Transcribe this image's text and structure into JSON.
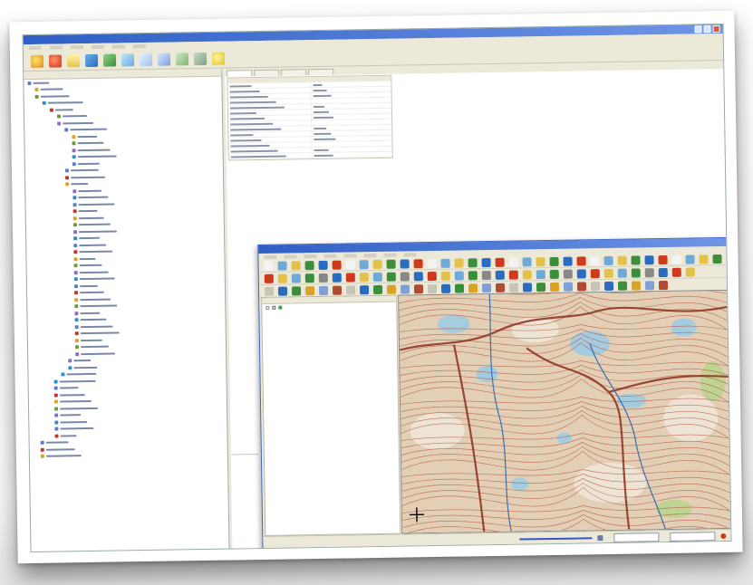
{
  "app": {
    "title": "",
    "menus": [
      "",
      "",
      "",
      "",
      "",
      ""
    ]
  },
  "toolbar": {
    "icons": [
      "refresh-icon",
      "connect-icon",
      "folder-icon",
      "layer-icon",
      "settings-icon",
      "add-icon",
      "table-icon",
      "sql-icon",
      "import-icon",
      "export-icon",
      "help-icon"
    ]
  },
  "tree": {
    "header": "",
    "items": [
      "",
      "",
      "",
      "",
      "",
      "",
      "",
      "",
      "",
      ""
    ]
  },
  "properties": {
    "tabs": [
      "",
      "",
      "",
      ""
    ],
    "columns": [
      "",
      ""
    ],
    "rows": [
      "",
      "",
      "",
      "",
      "",
      "",
      "",
      "",
      "",
      "",
      "",
      "",
      "",
      ""
    ]
  },
  "map_window": {
    "title": "",
    "menus": [
      "",
      "",
      "",
      "",
      "",
      "",
      "",
      ""
    ],
    "layer_name": "",
    "status": {
      "link": "",
      "coordinate_label": "",
      "coordinate_value": "",
      "scale_label": "",
      "scale_value": ""
    }
  },
  "colors": {
    "titlebar": "#2f5fc6",
    "chrome": "#ece9d8",
    "map_terrain": "#e2cfb6",
    "map_contours": "#b04a32",
    "map_lakes": "#9ecbe3"
  }
}
